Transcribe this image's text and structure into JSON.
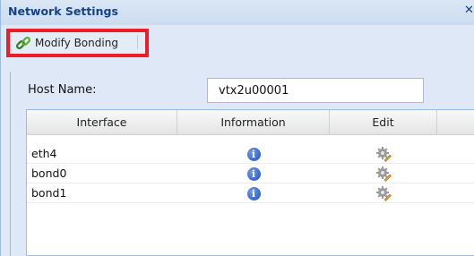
{
  "window": {
    "title": "Network Settings",
    "close_glyph": "✕"
  },
  "toolbar": {
    "modify_bonding_label": "Modify Bonding",
    "modify_bonding_icon": "link-icon"
  },
  "host": {
    "label": "Host Name:",
    "value": "vtx2u00001"
  },
  "grid": {
    "columns": [
      "Interface",
      "Information",
      "Edit",
      ""
    ],
    "rows": [
      {
        "interface": "eth4",
        "info_icon": "info-icon",
        "edit_icon": "gear-edit-icon"
      },
      {
        "interface": "bond0",
        "info_icon": "info-icon",
        "edit_icon": "gear-edit-icon"
      },
      {
        "interface": "bond1",
        "info_icon": "info-icon",
        "edit_icon": "gear-edit-icon"
      }
    ]
  },
  "colors": {
    "title": "#15428b",
    "highlight_border": "#ee1c24",
    "panel_bg": "#dfe8f6",
    "info_blue": "#1f4fb8"
  }
}
